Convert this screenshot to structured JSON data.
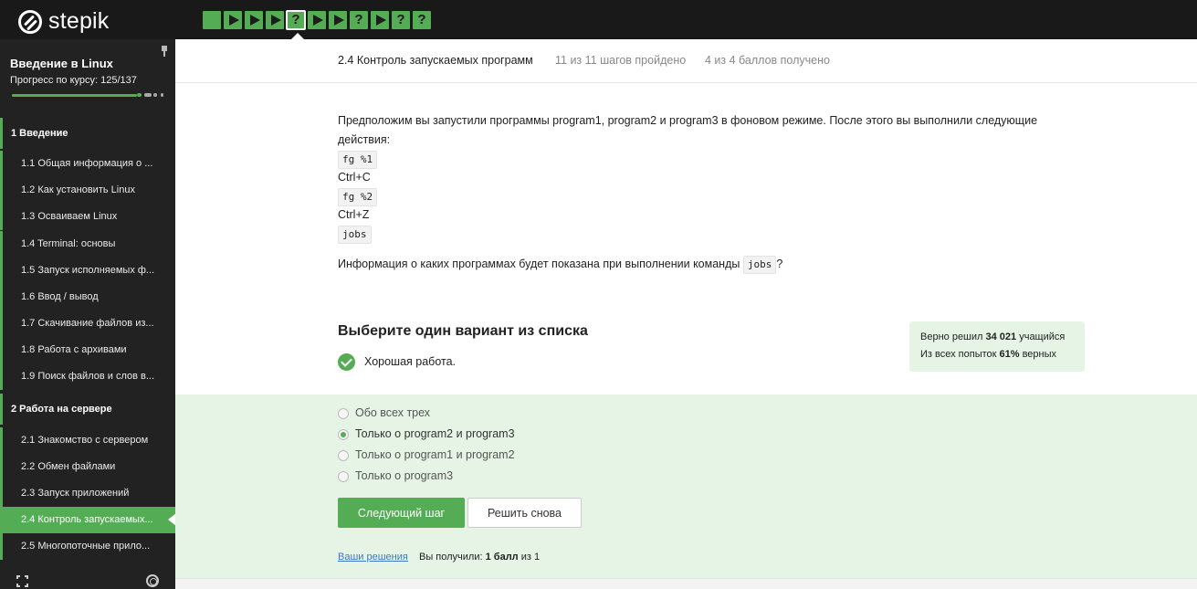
{
  "topbar": {
    "logo_text": "stepik",
    "steps": [
      {
        "type": "text",
        "symbol": "",
        "active": false
      },
      {
        "type": "video",
        "symbol": "",
        "active": false
      },
      {
        "type": "video",
        "symbol": "",
        "active": false
      },
      {
        "type": "video",
        "symbol": "",
        "active": false
      },
      {
        "type": "quiz",
        "symbol": "?",
        "active": true
      },
      {
        "type": "video",
        "symbol": "",
        "active": false
      },
      {
        "type": "video",
        "symbol": "",
        "active": false
      },
      {
        "type": "quiz",
        "symbol": "?",
        "active": false
      },
      {
        "type": "video",
        "symbol": "",
        "active": false
      },
      {
        "type": "quiz",
        "symbol": "?",
        "active": false
      },
      {
        "type": "quiz",
        "symbol": "?",
        "active": false
      }
    ],
    "accent_color": "#54ad54"
  },
  "sidebar": {
    "course_title": "Введение в Linux",
    "progress_label": "Прогресс по курсу:  125/137",
    "progress_fraction": 0.912,
    "modules": [
      {
        "label": "1  Введение",
        "lessons": [
          {
            "label": "1.1  Общая информация о ...",
            "active": false
          },
          {
            "label": "1.2  Как установить Linux",
            "active": false
          },
          {
            "label": "1.3  Осваиваем Linux",
            "active": false
          },
          {
            "label": "1.4  Terminal: основы",
            "active": false
          },
          {
            "label": "1.5  Запуск исполняемых ф...",
            "active": false
          },
          {
            "label": "1.6  Ввод / вывод",
            "active": false
          },
          {
            "label": "1.7  Скачивание файлов из...",
            "active": false
          },
          {
            "label": "1.8  Работа с архивами",
            "active": false
          },
          {
            "label": "1.9  Поиск файлов и слов в...",
            "active": false
          }
        ]
      },
      {
        "label": "2  Работа на сервере",
        "lessons": [
          {
            "label": "2.1  Знакомство с сервером",
            "active": false
          },
          {
            "label": "2.2  Обмен файлами",
            "active": false
          },
          {
            "label": "2.3  Запуск приложений",
            "active": false
          },
          {
            "label": "2.4  Контроль запускаемых...",
            "active": true
          },
          {
            "label": "2.5  Многопоточные прило...",
            "active": false
          }
        ]
      }
    ]
  },
  "lesson_header": {
    "title": "2.4 Контроль запускаемых программ",
    "steps_done": "11 из 11 шагов пройдено",
    "score": "4 из 4 баллов  получено"
  },
  "question": {
    "intro_line1": "Предположим вы запустили программы program1, program2 и program3 в фоновом режиме. После этого вы выполнили следующие",
    "intro_line2": "действия:",
    "cmd1": "fg %1",
    "action1": "Ctrl+C",
    "cmd2": "fg %2",
    "action2": "Ctrl+Z",
    "cmd3": "jobs",
    "ask_before": "Информация о каких программах будет показана при выполнении команды",
    "ask_code": "jobs",
    "ask_after": "?"
  },
  "quiz": {
    "choose_title": "Выберите один вариант из списка",
    "feedback": "Хорошая работа.",
    "stats": {
      "solved_prefix": "Верно решил ",
      "solved_count": "34 021",
      "solved_suffix": " учащийся",
      "attempts_prefix": "Из всех попыток ",
      "attempts_percent": "61%",
      "attempts_suffix": " верных"
    },
    "options": [
      {
        "label": "Обо всех трех",
        "selected": false
      },
      {
        "label": "Только о program2 и program3",
        "selected": true
      },
      {
        "label": "Только о program1 и program2",
        "selected": false
      },
      {
        "label": "Только о program3",
        "selected": false
      }
    ],
    "next_button": "Следующий шаг",
    "retry_button": "Решить снова",
    "solutions_link": "Ваши решения",
    "score_prefix": "Вы получили: ",
    "score_value": "1 балл",
    "score_suffix": " из 1"
  }
}
